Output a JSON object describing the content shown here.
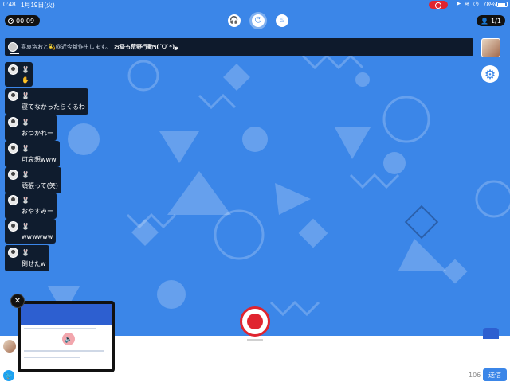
{
  "status_bar": {
    "time": "0:48",
    "date": "1月19日(火)",
    "battery": "78%"
  },
  "top_bar": {
    "timer": "00:09",
    "viewers": "1/1",
    "icons": [
      "headset-icon",
      "smile-icon",
      "flame-icon"
    ]
  },
  "banner": {
    "notice": "喜哀洛おと💫@近今新作出します。",
    "highlight": "お昼も荒野行動٩(ˊᗜˋ*)و"
  },
  "chats": [
    {
      "user_icon": "🐰",
      "message": "✋"
    },
    {
      "user_icon": "🐰",
      "message": "寝てなかったらくるわ"
    },
    {
      "user_icon": "🐰",
      "message": "おつかれー"
    },
    {
      "user_icon": "🐰",
      "message": "可哀想www"
    },
    {
      "user_icon": "🐰",
      "message": "頑張って(笑)"
    },
    {
      "user_icon": "🐰",
      "message": "おやすみー"
    },
    {
      "user_icon": "🐰",
      "message": "wwwwww"
    },
    {
      "user_icon": "🐰",
      "message": "倒せたw"
    }
  ],
  "input": {
    "char_count": "106",
    "send_label": "送信"
  },
  "colors": {
    "background": "#3b86e8",
    "accent": "#e0242f",
    "chat_bg": "#0f1c2e"
  }
}
